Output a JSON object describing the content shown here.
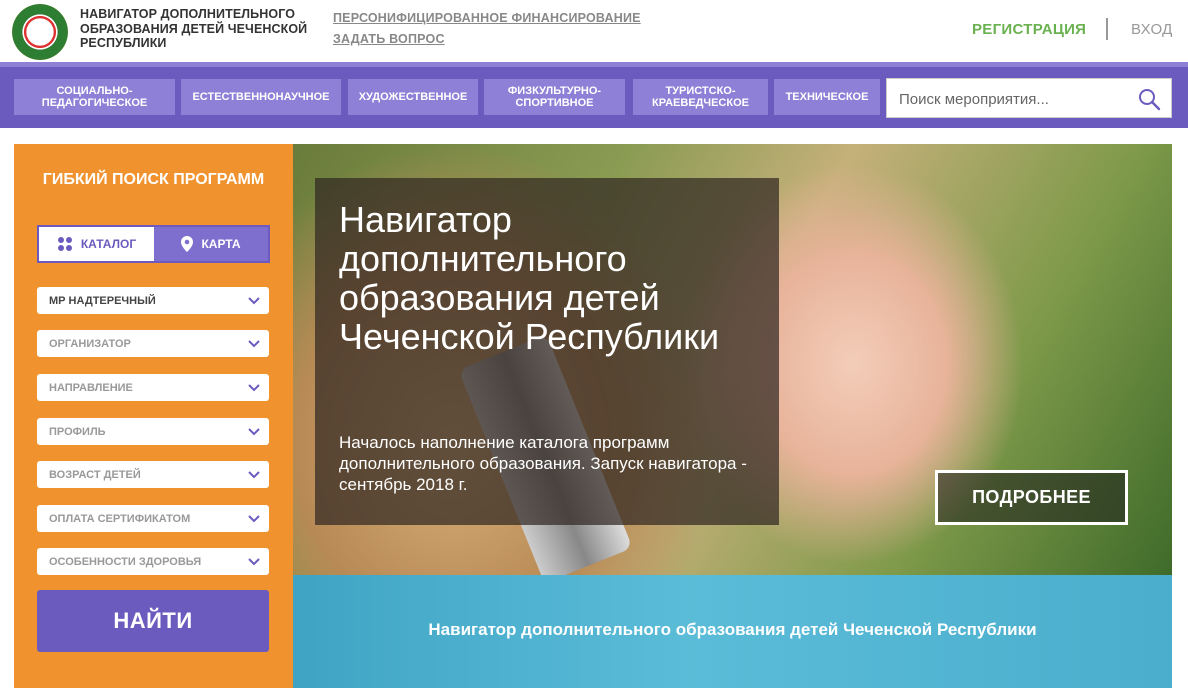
{
  "header": {
    "logo_text": "НАВИГАТОР ДОПОЛНИТЕЛЬНОГО ОБРАЗОВАНИЯ ДЕТЕЙ ЧЕЧЕНСКОЙ РЕСПУБЛИКИ",
    "links": [
      "ПЕРСОНИФИЦИРОВАННОЕ ФИНАНСИРОВАНИЕ",
      "ЗАДАТЬ ВОПРОС"
    ],
    "register": "РЕГИСТРАЦИЯ",
    "login": "ВХОД"
  },
  "nav": {
    "items": [
      "СОЦИАЛЬНО-ПЕДАГОГИЧЕСКОЕ",
      "ЕСТЕСТВЕННОНАУЧНОЕ",
      "ХУДОЖЕСТВЕННОЕ",
      "ФИЗКУЛЬТУРНО-СПОРТИВНОЕ",
      "ТУРИСТСКО-КРАЕВЕДЧЕСКОЕ",
      "ТЕХНИЧЕСКОЕ"
    ],
    "search_placeholder": "Поиск мероприятия..."
  },
  "sidebar": {
    "title": "ГИБКИЙ ПОИСК ПРОГРАММ",
    "catalog": "КАТАЛОГ",
    "map": "КАРТА",
    "filters": [
      "МР НАДТЕРЕЧНЫЙ",
      "ОРГАНИЗАТОР",
      "НАПРАВЛЕНИЕ",
      "ПРОФИЛЬ",
      "ВОЗРАСТ ДЕТЕЙ",
      "ОПЛАТА СЕРТИФИКАТОМ",
      "ОСОБЕННОСТИ ЗДОРОВЬЯ"
    ],
    "find": "НАЙТИ"
  },
  "hero": {
    "title": "Навигатор дополнительного образования детей Чеченской Республики",
    "text": "Началось наполнение каталога программ дополнительного образования. Запуск навигатора - сентябрь 2018 г.",
    "more": "ПОДРОБНЕЕ"
  },
  "banner": {
    "text": "Навигатор дополнительного образования детей Чеченской Республики"
  },
  "colors": {
    "purple": "#6b5bbf",
    "nav_item": "#8d80d6",
    "orange": "#f0932f",
    "green": "#6ab150"
  }
}
